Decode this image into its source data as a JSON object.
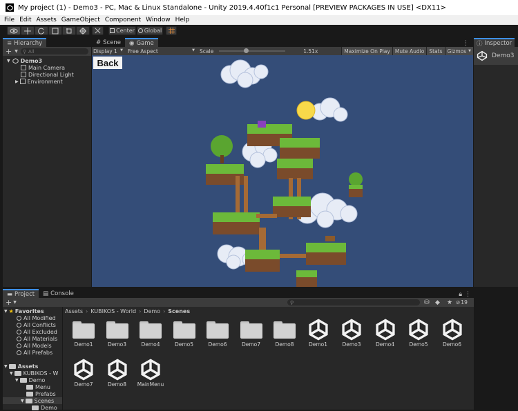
{
  "window": {
    "title": "My project (1) - Demo3 - PC, Mac & Linux Standalone - Unity 2019.4.40f1c1 Personal [PREVIEW PACKAGES IN USE] <DX11>"
  },
  "menu": [
    "File",
    "Edit",
    "Assets",
    "GameObject",
    "Component",
    "Window",
    "Help"
  ],
  "toolbar": {
    "center_label": "Center",
    "global_label": "Global"
  },
  "hierarchy": {
    "tab": "Hierarchy",
    "search_placeholder": "All",
    "items": [
      {
        "label": "Demo3"
      },
      {
        "label": "Main Camera"
      },
      {
        "label": "Directional Light"
      },
      {
        "label": "Environment"
      }
    ]
  },
  "scene_tabs": {
    "scene": "Scene",
    "game": "Game"
  },
  "game_bar": {
    "display": "Display 1",
    "aspect": "Free Aspect",
    "scale_label": "Scale",
    "scale_value": "1.51x",
    "maximize": "Maximize On Play",
    "mute": "Mute Audio",
    "stats": "Stats",
    "gizmos": "Gizmos",
    "scale_fraction": 0.4
  },
  "game_view": {
    "back_button": "Back",
    "bg_color": "#344d78"
  },
  "inspector": {
    "tab": "Inspector",
    "object": "Demo3"
  },
  "project": {
    "tabs": {
      "project": "Project",
      "console": "Console"
    },
    "hidden_count": "19",
    "favorites_label": "Favorites",
    "favorites": [
      "All Modified",
      "All Conflicts",
      "All Excluded",
      "All Materials",
      "All Models",
      "All Prefabs"
    ],
    "assets_label": "Assets",
    "tree": [
      "KUBIKOS - W",
      "Demo",
      "Menu",
      "Prefabs",
      "Scenes",
      "Demo"
    ],
    "breadcrumb": [
      "Assets",
      "KUBIKOS - World",
      "Demo",
      "Scenes"
    ],
    "grid": [
      {
        "label": "Demo1",
        "kind": "folder"
      },
      {
        "label": "Demo3",
        "kind": "folder"
      },
      {
        "label": "Demo4",
        "kind": "folder"
      },
      {
        "label": "Demo5",
        "kind": "folder"
      },
      {
        "label": "Demo6",
        "kind": "folder"
      },
      {
        "label": "Demo7",
        "kind": "folder"
      },
      {
        "label": "Demo8",
        "kind": "folder"
      },
      {
        "label": "Demo1",
        "kind": "scene"
      },
      {
        "label": "Demo3",
        "kind": "scene",
        "selected": true
      },
      {
        "label": "Demo4",
        "kind": "scene"
      },
      {
        "label": "Demo5",
        "kind": "scene"
      },
      {
        "label": "Demo6",
        "kind": "scene"
      },
      {
        "label": "Demo7",
        "kind": "scene"
      },
      {
        "label": "Demo8",
        "kind": "scene"
      },
      {
        "label": "MainMenu",
        "kind": "scene"
      }
    ]
  },
  "colors": {
    "accent": "#3d8fe6",
    "selection": "#2c5d87",
    "panel": "#282828"
  }
}
